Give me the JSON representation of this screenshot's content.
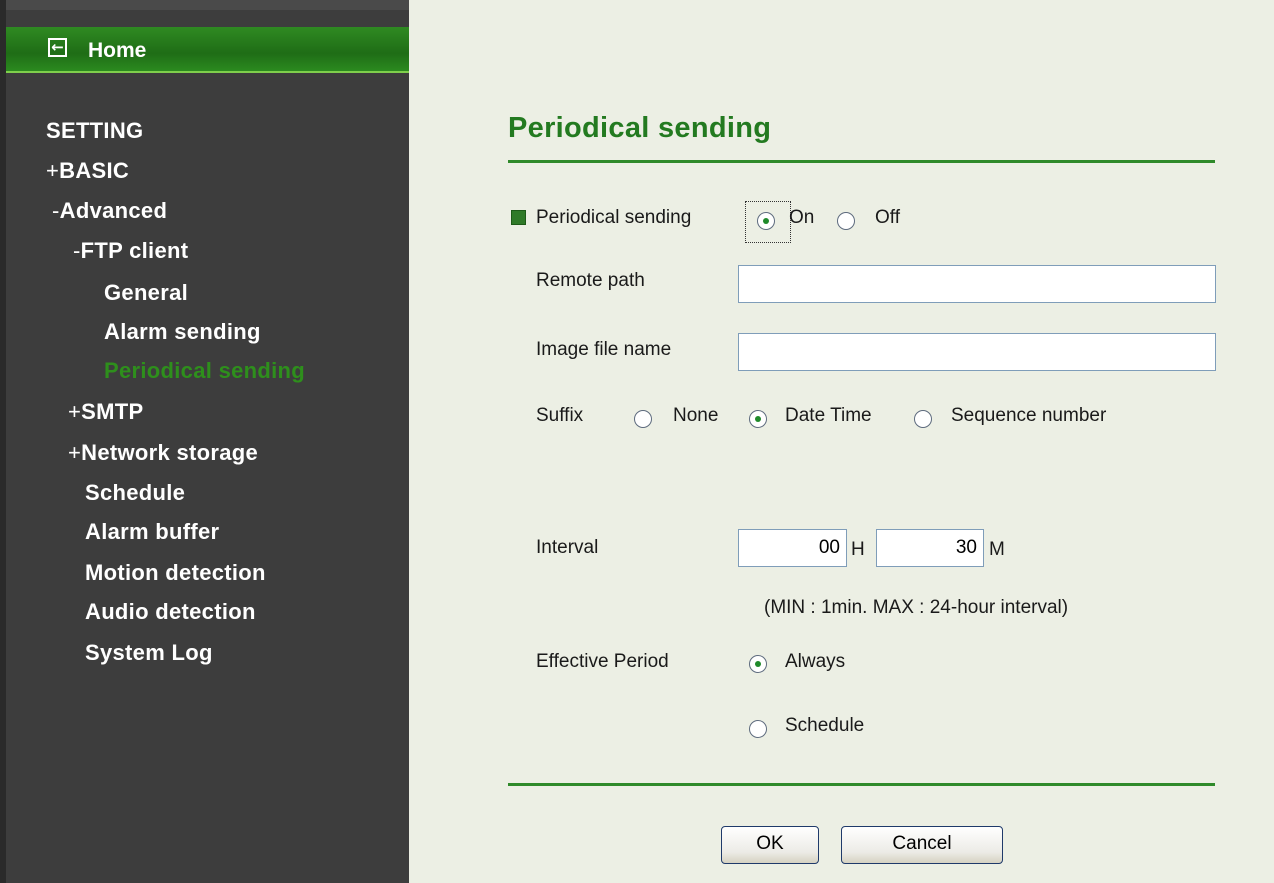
{
  "sidebar": {
    "home_label": "Home",
    "items": [
      {
        "prefix": "",
        "label": "SETTING"
      },
      {
        "prefix": "+",
        "label": "BASIC"
      },
      {
        "prefix": "-",
        "label": "Advanced"
      },
      {
        "prefix": "-",
        "label": "FTP client"
      },
      {
        "prefix": "",
        "label": "General"
      },
      {
        "prefix": "",
        "label": "Alarm sending"
      },
      {
        "prefix": "",
        "label": "Periodical sending"
      },
      {
        "prefix": "+",
        "label": "SMTP"
      },
      {
        "prefix": "+",
        "label": "Network storage"
      },
      {
        "prefix": "",
        "label": "Schedule"
      },
      {
        "prefix": "",
        "label": "Alarm buffer"
      },
      {
        "prefix": "",
        "label": "Motion detection"
      },
      {
        "prefix": "",
        "label": "Audio detection"
      },
      {
        "prefix": "",
        "label": "System Log"
      }
    ],
    "active_item": "Periodical sending"
  },
  "main": {
    "title": "Periodical sending",
    "periodical": {
      "label": "Periodical sending",
      "on_label": "On",
      "off_label": "Off",
      "selected": "On"
    },
    "remote_path": {
      "label": "Remote path",
      "value": ""
    },
    "image_file_name": {
      "label": "Image file name",
      "value": ""
    },
    "suffix": {
      "label": "Suffix",
      "options": [
        "None",
        "Date Time",
        "Sequence number"
      ],
      "selected": "Date Time"
    },
    "interval": {
      "label": "Interval",
      "hours": "00",
      "hours_unit": "H",
      "minutes": "30",
      "minutes_unit": "M",
      "note": "(MIN : 1min. MAX : 24-hour interval)"
    },
    "effective_period": {
      "label": "Effective Period",
      "options": [
        "Always",
        "Schedule"
      ],
      "selected": "Always"
    },
    "buttons": {
      "ok": "OK",
      "cancel": "Cancel"
    }
  },
  "colors": {
    "accent_green": "#237a20",
    "sidebar_bg": "#3d3d3d",
    "active_nav": "#2e8f1c",
    "panel_bg": "#ecefe4"
  },
  "icons": {
    "home": "arrow-left-box-icon"
  }
}
